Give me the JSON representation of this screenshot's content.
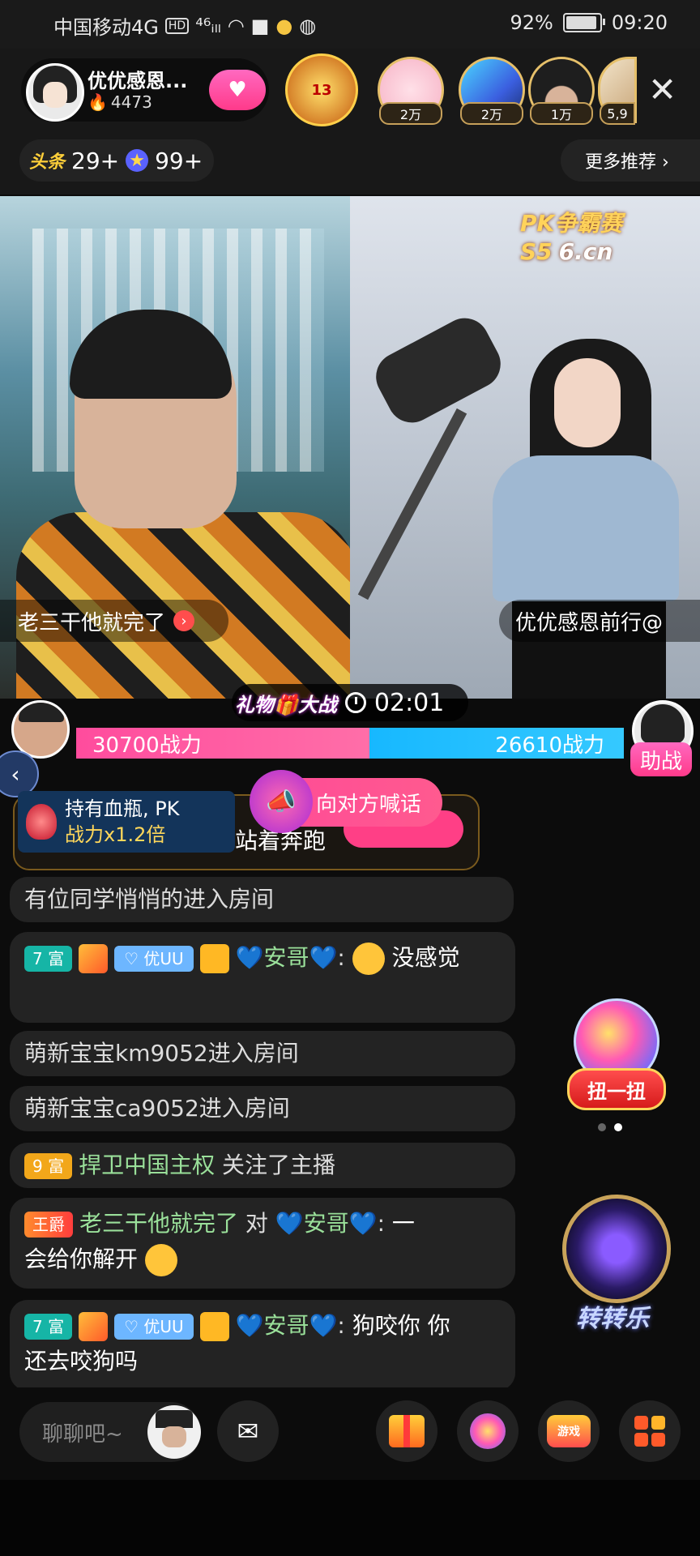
{
  "status_bar": {
    "carrier": "中国移动4G",
    "hd": "HD",
    "signal": "⁴⁶ᵢₗₗ",
    "battery_pct": "92%",
    "time": "09:20"
  },
  "host": {
    "name": "优优感恩...",
    "heat": "4473",
    "follow_icon": "heart-icon",
    "rank_label": "13"
  },
  "fans": [
    {
      "count": "2万"
    },
    {
      "count": "2万"
    },
    {
      "count": "1万"
    },
    {
      "count": "5,9"
    }
  ],
  "headline": {
    "tt_label": "头条",
    "count1": "29+",
    "count2": "99+"
  },
  "more_recommend": "更多推荐 ›",
  "video": {
    "pk_logo": "PK争霸赛S5",
    "site": "6.cn",
    "left_name": "老三干他就完了",
    "right_name": "优优感恩前行@"
  },
  "pk": {
    "gift_war": "礼物🎁大战",
    "timer": "02:01",
    "left_power": "30700战力",
    "right_power": "26610战力",
    "left_share": 0.536,
    "assist": "助战",
    "potion_line1": "持有血瓶, PK",
    "potion_line2": "战力x1.2倍",
    "shout": "向对方喊话",
    "task_text": "站着奔跑"
  },
  "chat": [
    {
      "kind": "system",
      "text": "有位同学悄悄的进入房间"
    },
    {
      "kind": "user",
      "level": "7 富",
      "club": "优UU",
      "user": "💙安哥💙",
      "sep": ":",
      "text": "没感觉"
    },
    {
      "kind": "system",
      "text": "萌新宝宝km9052进入房间"
    },
    {
      "kind": "system",
      "text": "萌新宝宝ca9052进入房间"
    },
    {
      "kind": "follow",
      "level": "9 富",
      "user": "捍卫中国主权",
      "text": "关注了主播"
    },
    {
      "kind": "reply",
      "badge": "王爵",
      "user": "老三干他就完了",
      "to_word": "对",
      "target": "💙安哥💙",
      "sep": ":",
      "text1": "一",
      "text2": "会给你解开"
    },
    {
      "kind": "user2",
      "level": "7 富",
      "club": "优UU",
      "user": "💙安哥💙",
      "sep": ":",
      "text1": "狗咬你 你",
      "text2": "还去咬狗吗"
    }
  ],
  "widgets": {
    "gacha_label": "扭一扭",
    "wheel_label": "转转乐"
  },
  "bottom": {
    "input_placeholder": "聊聊吧~",
    "game_label": "游戏"
  },
  "colors": {
    "pink": "#ff4c9d",
    "blue": "#17b8ff",
    "accent_gold": "#ffd04a"
  }
}
